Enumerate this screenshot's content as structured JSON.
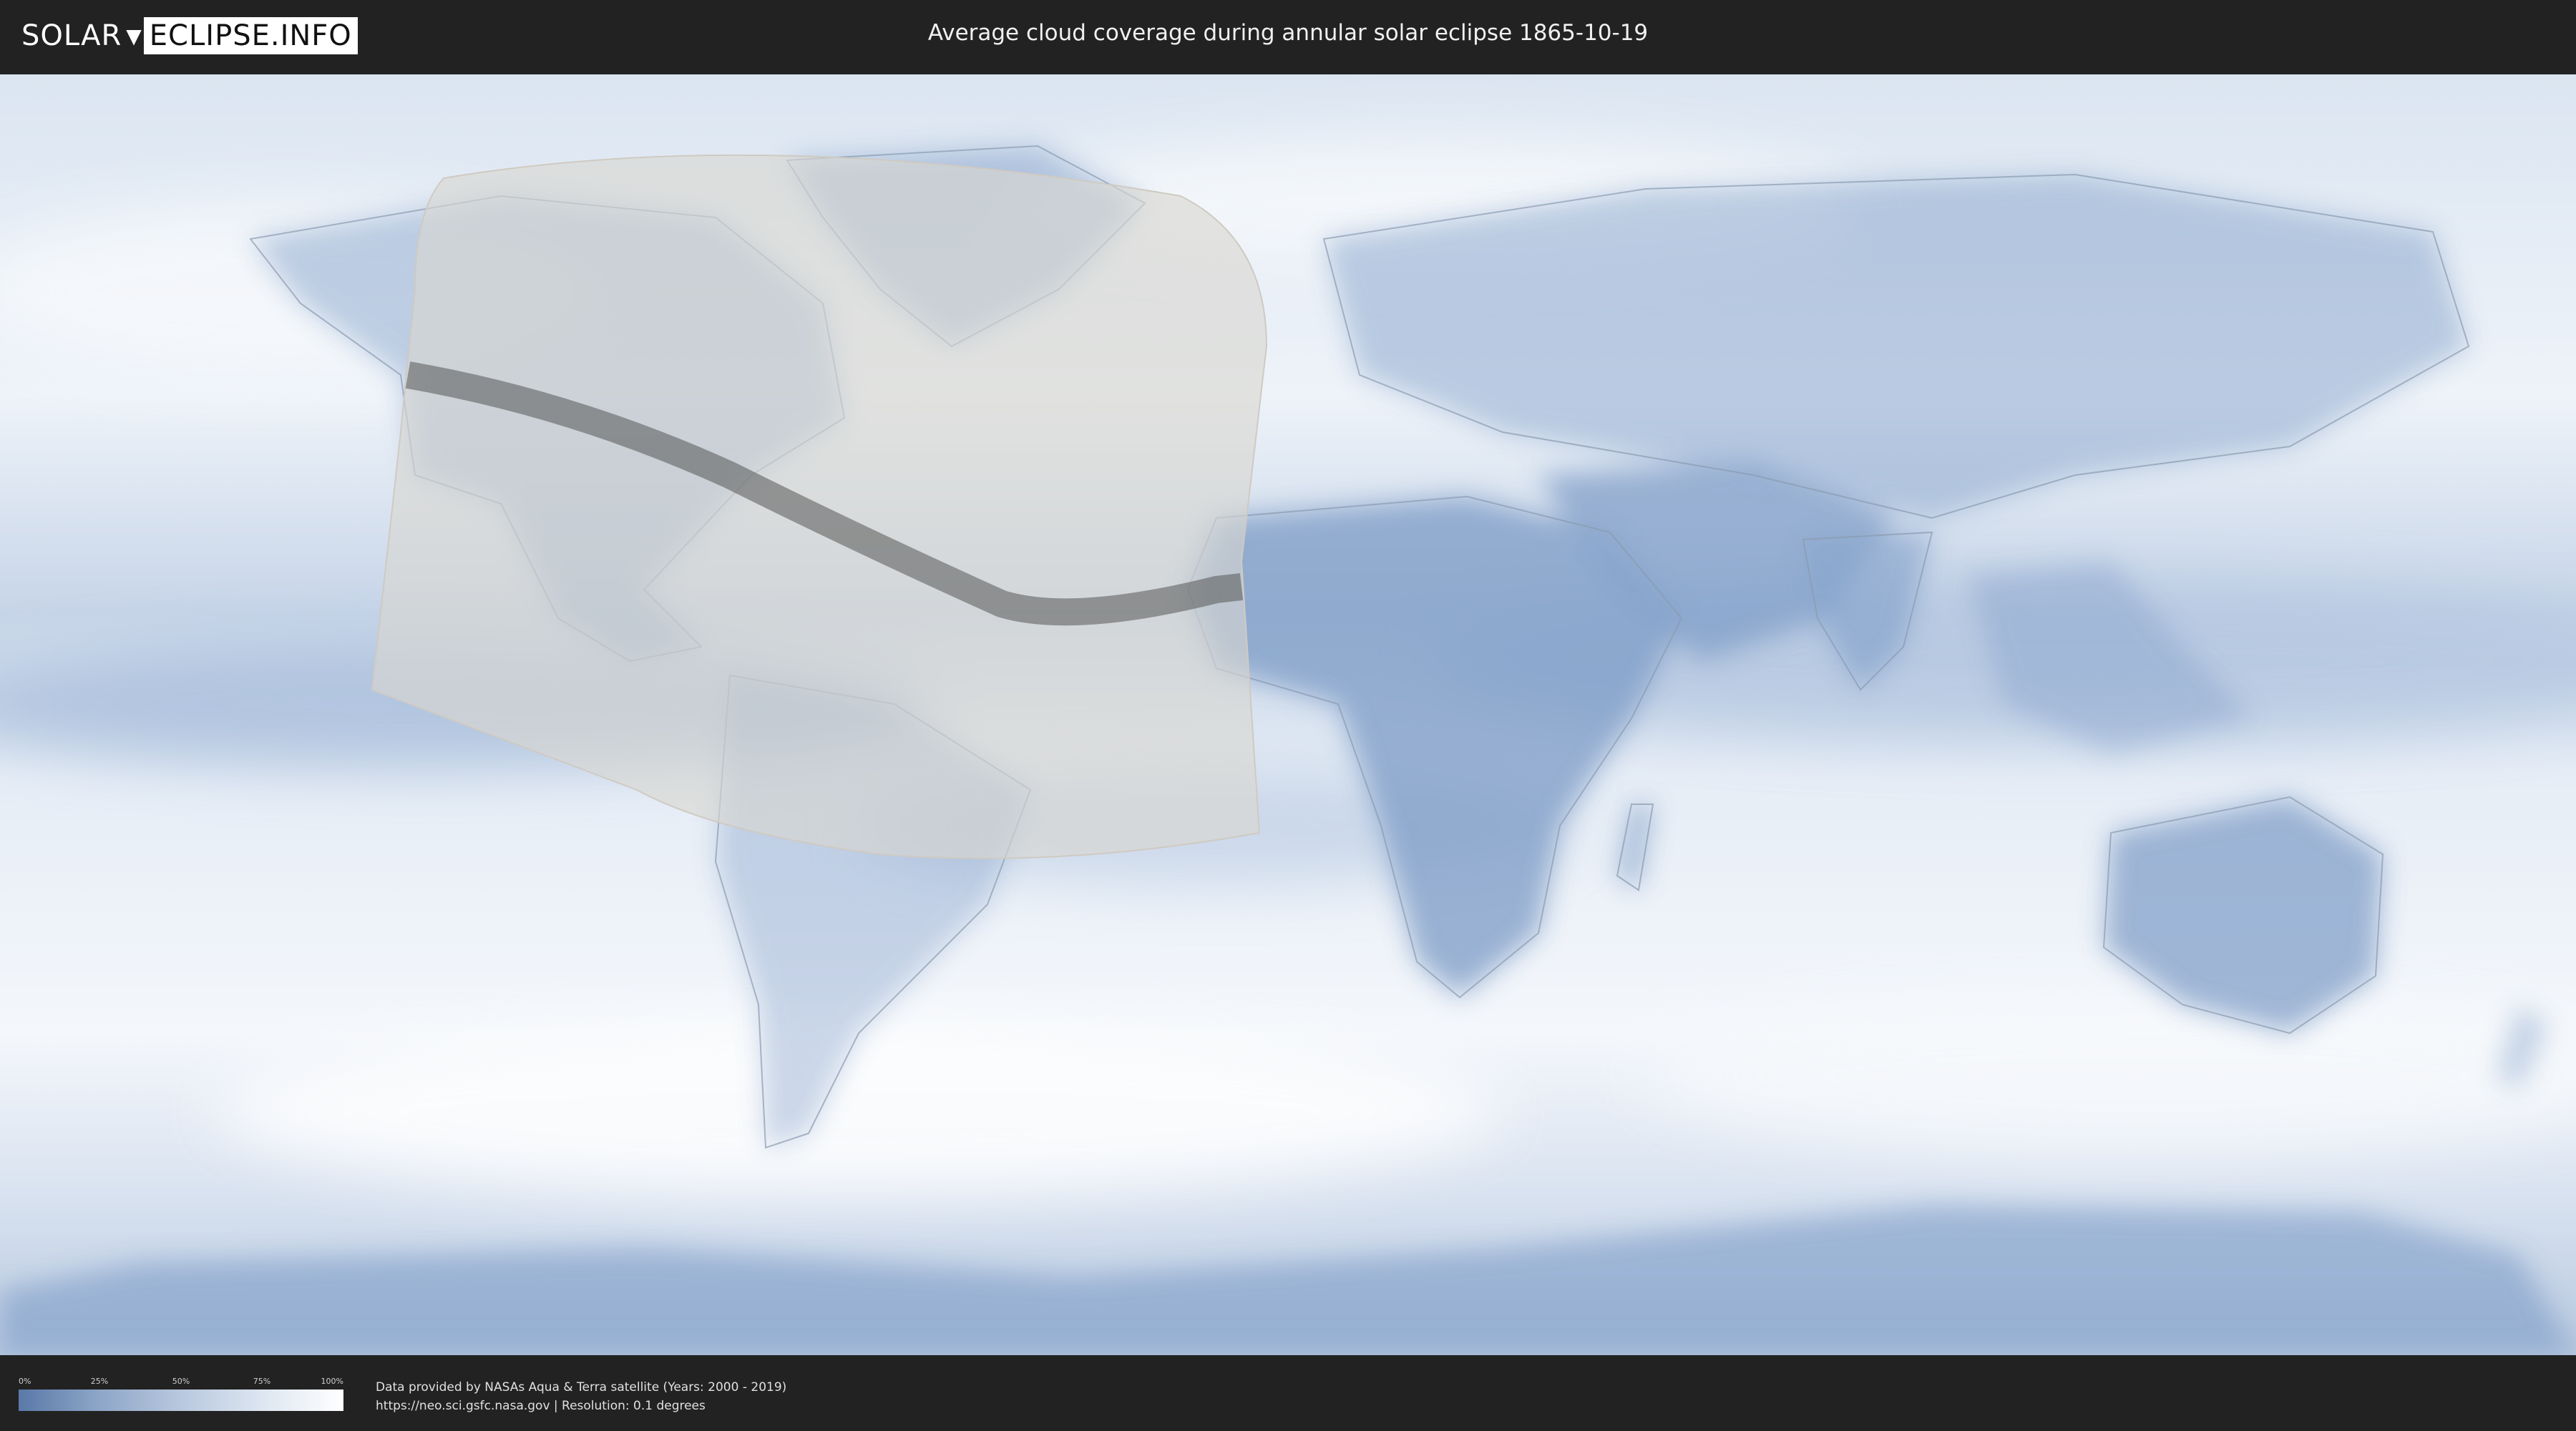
{
  "header": {
    "logo": {
      "left": "SOLAR",
      "right": "ECLIPSE.INFO"
    },
    "title": "Average cloud coverage during annular solar eclipse 1865-10-19"
  },
  "legend": {
    "ticks": [
      "0%",
      "25%",
      "50%",
      "75%",
      "100%"
    ],
    "gradient_colors": [
      "#5a79a8",
      "#ffffff"
    ]
  },
  "footer": {
    "credit_line1": "Data provided by NASAs Aqua & Terra satellite (Years: 2000 - 2019)",
    "credit_line2": "https://neo.sci.gsfc.nasa.gov | Resolution: 0.1 degrees"
  },
  "map": {
    "colors": {
      "ocean_clear": "#eef3f9",
      "cloud_low": "#6f8fbd",
      "visibility_overlay": "#d9d6d0",
      "annular_path": "#555555"
    }
  }
}
